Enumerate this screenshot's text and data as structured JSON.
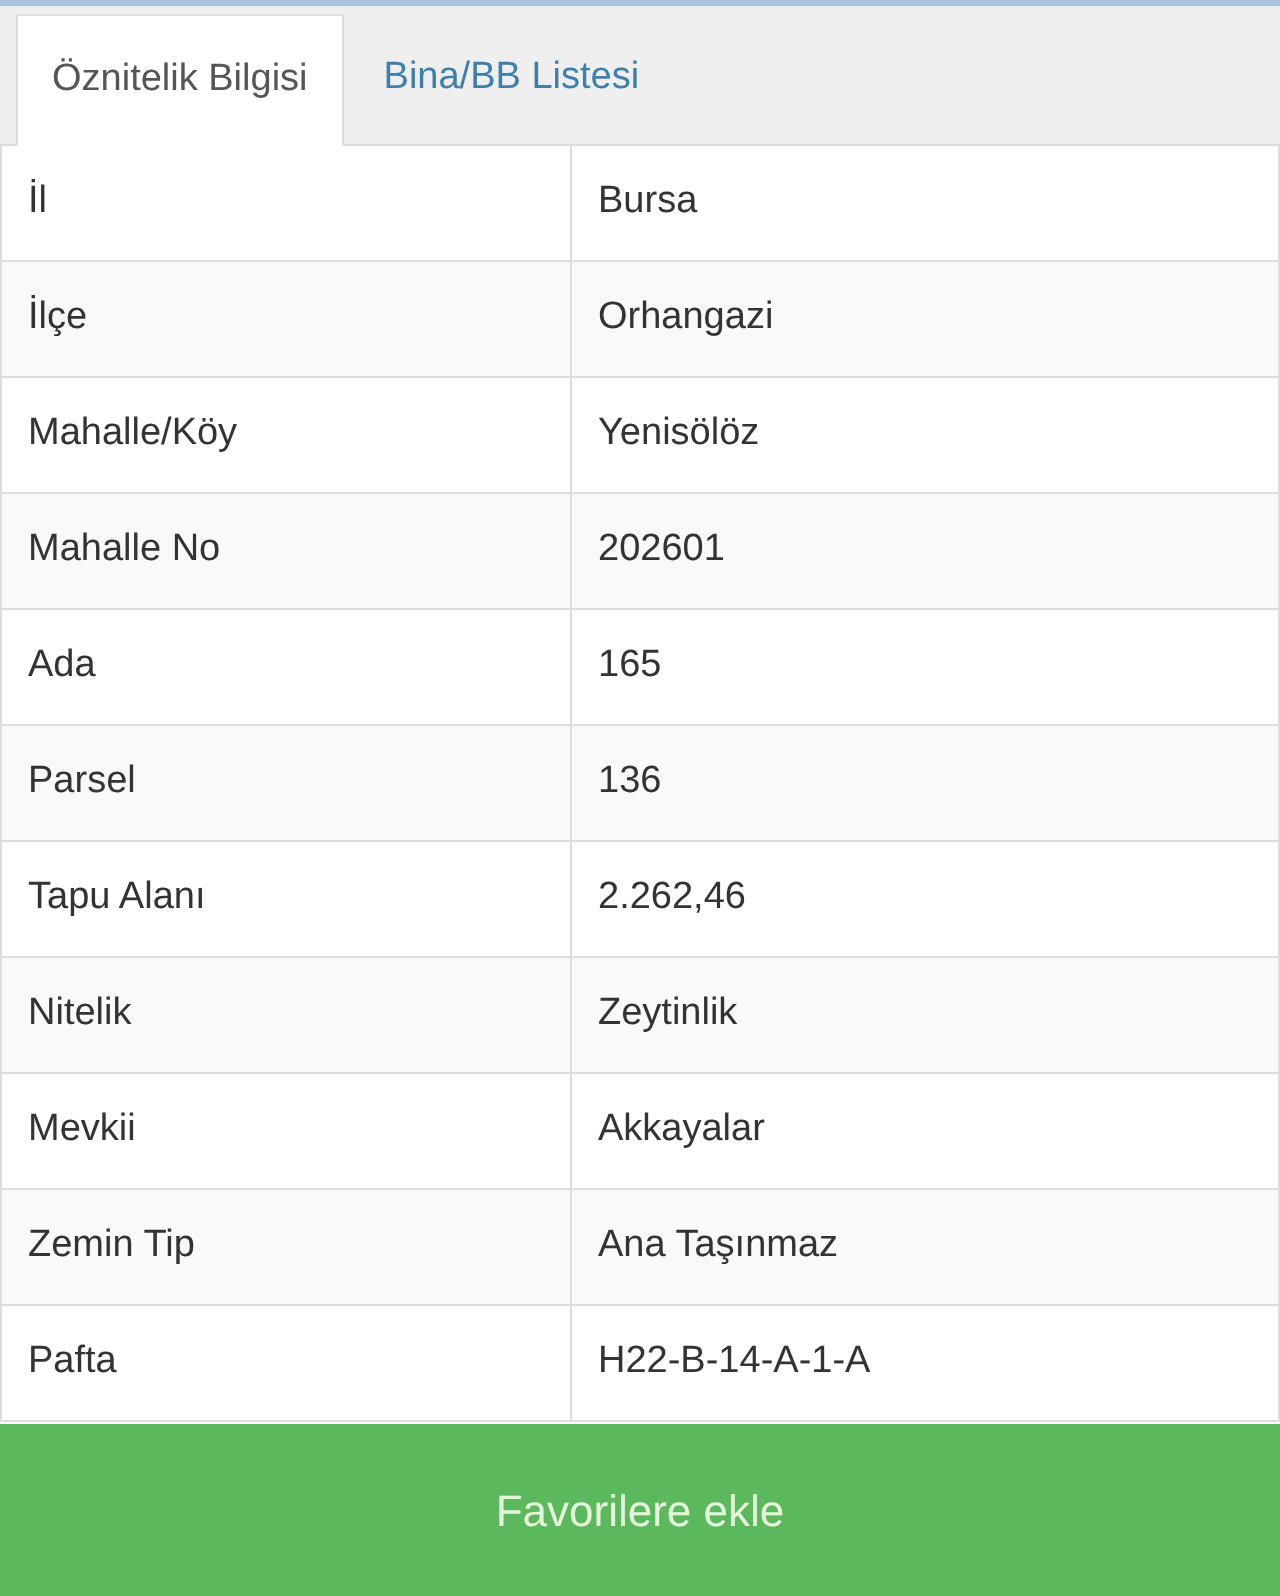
{
  "tabs": [
    {
      "label": "Öznitelik Bilgisi",
      "selected": true
    },
    {
      "label": "Bina/BB Listesi",
      "selected": false
    }
  ],
  "table": {
    "rows": [
      {
        "label": "İl",
        "value": "Bursa"
      },
      {
        "label": "İlçe",
        "value": "Orhangazi"
      },
      {
        "label": "Mahalle/Köy",
        "value": "Yenisölöz"
      },
      {
        "label": "Mahalle No",
        "value": "202601"
      },
      {
        "label": "Ada",
        "value": "165"
      },
      {
        "label": "Parsel",
        "value": "136"
      },
      {
        "label": "Tapu Alanı",
        "value": "2.262,46"
      },
      {
        "label": "Nitelik",
        "value": "Zeytinlik"
      },
      {
        "label": "Mevkii",
        "value": "Akkayalar"
      },
      {
        "label": "Zemin Tip",
        "value": "Ana Taşınmaz"
      },
      {
        "label": "Pafta",
        "value": "H22-B-14-A-1-A"
      }
    ]
  },
  "button": {
    "label": "Favorilere ekle"
  }
}
